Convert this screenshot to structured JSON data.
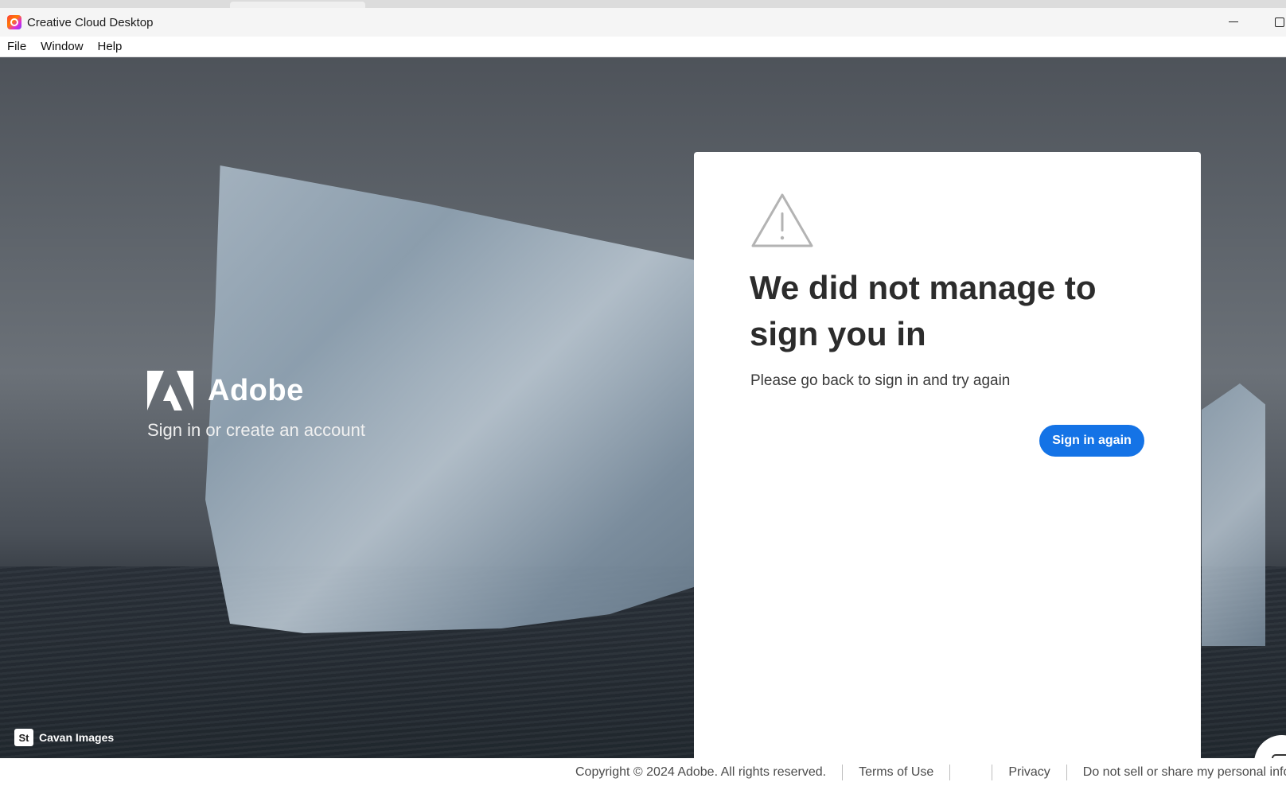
{
  "window": {
    "title": "Creative Cloud Desktop"
  },
  "menu": {
    "items": [
      "File",
      "Window",
      "Help"
    ]
  },
  "brand": {
    "name": "Adobe",
    "tagline": "Sign in or create an account"
  },
  "credit": {
    "badge": "St",
    "text": "Cavan Images"
  },
  "card": {
    "heading": "We did not manage to sign you in",
    "description": "Please go back to sign in and try again",
    "button_label": "Sign in again"
  },
  "footer": {
    "copyright": "Copyright © 2024 Adobe. All rights reserved.",
    "terms": "Terms of Use",
    "privacy": "Privacy",
    "do_not_sell": "Do not sell or share my personal inform"
  },
  "colors": {
    "accent": "#1473e6",
    "heading": "#2c2c2c"
  },
  "icons": [
    "app-icon",
    "minimize-icon",
    "maximize-icon",
    "adobe-logo-icon",
    "warning-icon",
    "chat-icon"
  ]
}
